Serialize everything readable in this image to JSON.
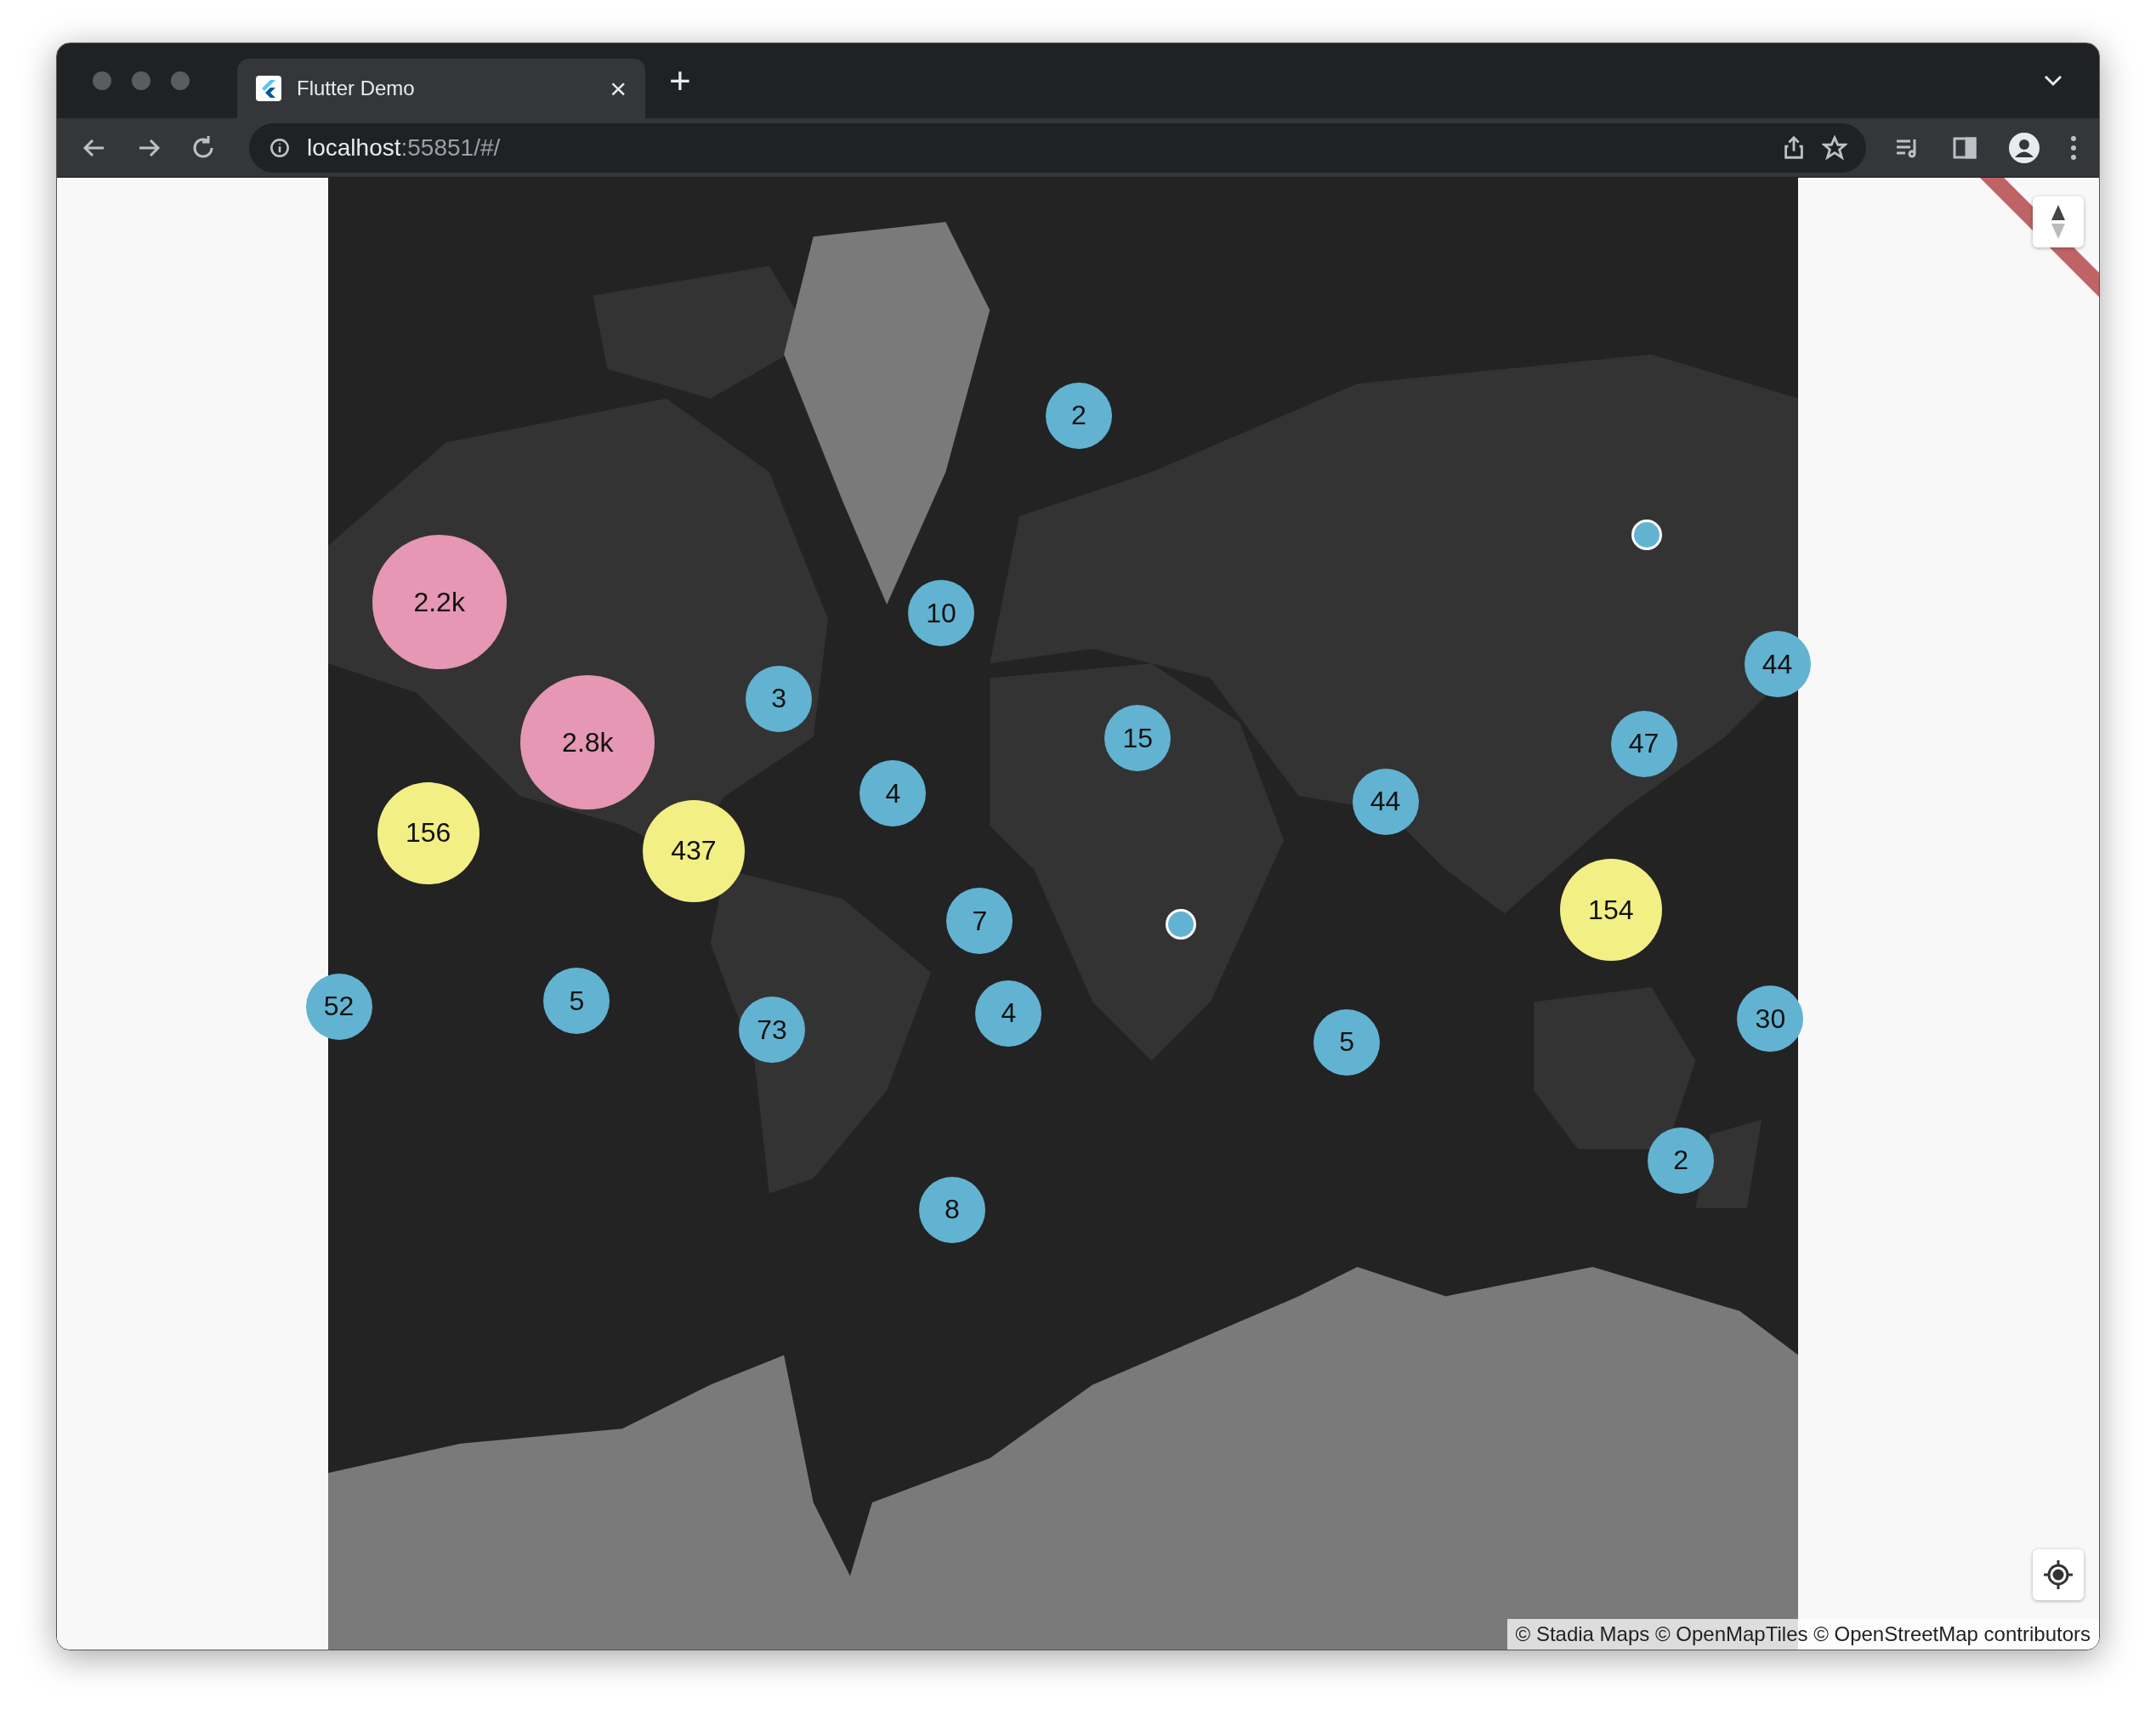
{
  "browser": {
    "tab": {
      "title": "Flutter Demo",
      "selected": true
    },
    "close_tab": "×",
    "new_tab_button": "+",
    "address": {
      "host": "localhost",
      "path": ":55851/#/"
    }
  },
  "map": {
    "kind": "picture",
    "clusters": [
      {
        "kind": "cluster",
        "label": "2",
        "color": "#62b3d1"
      },
      {
        "kind": "dot",
        "color": "#62b3d1"
      },
      {
        "kind": "cluster",
        "label": "2.2k",
        "color": "#e597b3"
      },
      {
        "kind": "cluster",
        "label": "10",
        "color": "#62b3d1"
      },
      {
        "kind": "cluster",
        "label": "44",
        "color": "#62b3d1"
      },
      {
        "kind": "cluster",
        "label": "3",
        "color": "#62b3d1"
      },
      {
        "kind": "cluster",
        "label": "2.8k",
        "color": "#e597b3"
      },
      {
        "kind": "cluster",
        "label": "15",
        "color": "#62b3d1"
      },
      {
        "kind": "cluster",
        "label": "47",
        "color": "#62b3d1"
      },
      {
        "kind": "cluster",
        "label": "4",
        "color": "#62b3d1"
      },
      {
        "kind": "cluster",
        "label": "44",
        "color": "#62b3d1"
      },
      {
        "kind": "cluster",
        "label": "156",
        "color": "#f2ef84"
      },
      {
        "kind": "cluster",
        "label": "437",
        "color": "#f2ef84"
      },
      {
        "kind": "cluster",
        "label": "154",
        "color": "#f2ef84"
      },
      {
        "kind": "cluster",
        "label": "7",
        "color": "#62b3d1"
      },
      {
        "kind": "dot",
        "color": "#62b3d1"
      },
      {
        "kind": "cluster",
        "label": "52",
        "color": "#62b3d1"
      },
      {
        "kind": "cluster",
        "label": "5",
        "color": "#62b3d1"
      },
      {
        "kind": "cluster",
        "label": "4",
        "color": "#62b3d1"
      },
      {
        "kind": "cluster",
        "label": "30",
        "color": "#62b3d1"
      },
      {
        "kind": "cluster",
        "label": "73",
        "color": "#62b3d1"
      },
      {
        "kind": "cluster",
        "label": "5",
        "color": "#62b3d1"
      },
      {
        "kind": "cluster",
        "label": "2",
        "color": "#62b3d1"
      },
      {
        "kind": "cluster",
        "label": "8",
        "color": "#62b3d1"
      }
    ],
    "attribution": "© Stadia Maps © OpenMapTiles © OpenStreetMap contributors"
  }
}
